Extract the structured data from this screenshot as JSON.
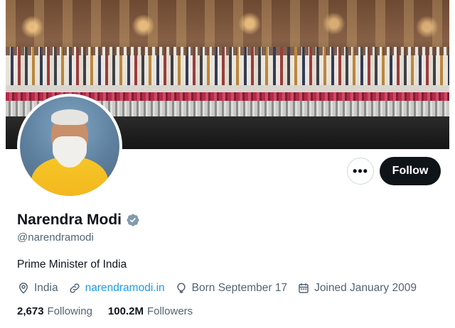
{
  "profile": {
    "display_name": "Narendra Modi",
    "handle": "@narendramodi",
    "verified": true,
    "bio": "Prime Minister of India",
    "location": "India",
    "website": "narendramodi.in",
    "born": "Born September 17",
    "joined": "Joined January 2009"
  },
  "stats": {
    "following_value": "2,673",
    "following_label": "Following",
    "followers_value": "100.2M",
    "followers_label": "Followers"
  },
  "actions": {
    "more_label": "•••",
    "follow_label": "Follow"
  },
  "colors": {
    "accent": "#1d9bf0",
    "text_primary": "#0f1419",
    "text_secondary": "#536471",
    "follow_bg": "#0f1419",
    "verified_badge": "#829aab"
  },
  "icons": {
    "location": "location-pin-icon",
    "website": "link-icon",
    "born": "balloon-icon",
    "joined": "calendar-icon",
    "verified": "verified-badge-icon",
    "more": "more-horizontal-icon"
  }
}
